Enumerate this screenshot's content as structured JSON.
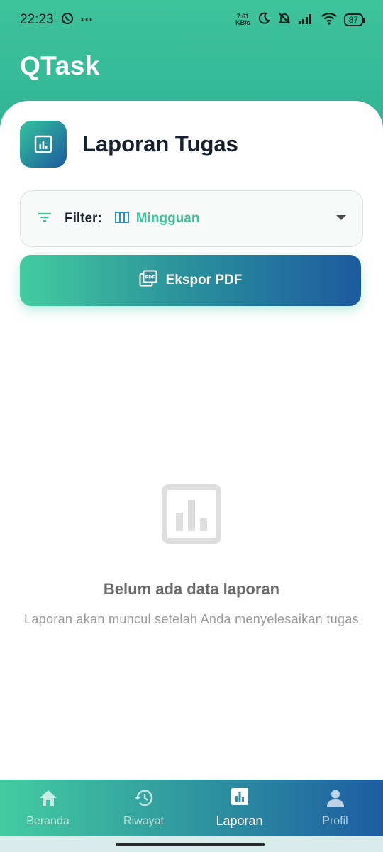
{
  "status_bar": {
    "time": "22:23",
    "dots": "···",
    "net_speed_value": "7.61",
    "net_speed_unit": "KB/s",
    "battery": "87"
  },
  "app": {
    "title": "QTask"
  },
  "header": {
    "title": "Laporan Tugas"
  },
  "filter": {
    "label": "Filter:",
    "value": "Mingguan"
  },
  "export_button": {
    "label": "Ekspor PDF"
  },
  "empty_state": {
    "title": "Belum ada data laporan",
    "subtitle": "Laporan akan muncul setelah Anda menyelesaikan tugas"
  },
  "bottom_nav": {
    "items": [
      {
        "label": "Beranda",
        "icon": "home-icon"
      },
      {
        "label": "Riwayat",
        "icon": "history-icon"
      },
      {
        "label": "Laporan",
        "icon": "bar-chart-icon",
        "active": true
      },
      {
        "label": "Profil",
        "icon": "person-icon"
      }
    ]
  },
  "colors": {
    "accent_green": "#3cc39a",
    "accent_blue": "#1d5aa0",
    "title_text": "#17202e"
  }
}
